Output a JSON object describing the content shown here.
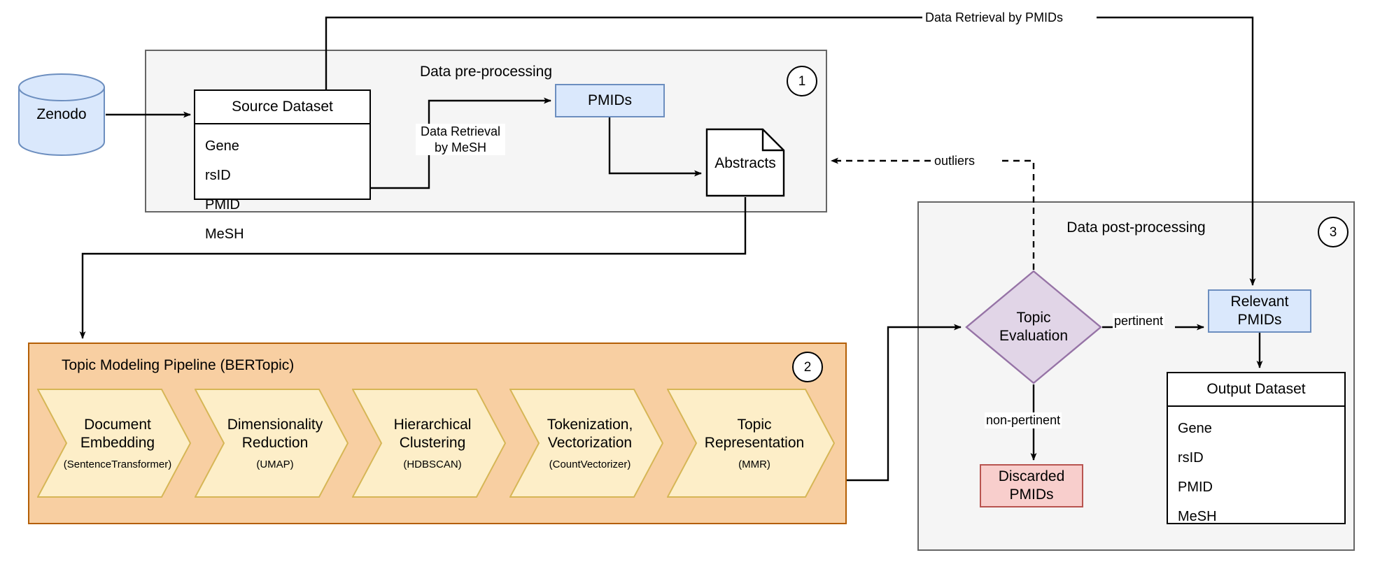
{
  "groups": {
    "preprocessing": {
      "title": "Data pre-processing",
      "badge": "1"
    },
    "pipeline": {
      "title": "Topic Modeling Pipeline (BERTopic)",
      "badge": "2"
    },
    "postprocessing": {
      "title": "Data post-processing",
      "badge": "3"
    }
  },
  "nodes": {
    "zenodo": {
      "label": "Zenodo"
    },
    "source_dataset": {
      "title": "Source Dataset",
      "fields": [
        "Gene",
        "rsID",
        "PMID",
        "MeSH"
      ]
    },
    "pmids": {
      "label": "PMIDs"
    },
    "abstracts": {
      "label": "Abstracts"
    },
    "topic_evaluation": {
      "label": "Topic\nEvaluation"
    },
    "relevant_pmids": {
      "label": "Relevant\nPMIDs"
    },
    "discarded_pmids": {
      "label": "Discarded\nPMIDs"
    },
    "output_dataset": {
      "title": "Output Dataset",
      "fields": [
        "Gene",
        "rsID",
        "PMID",
        "MeSH"
      ]
    }
  },
  "pipeline_steps": [
    {
      "title": "Document\nEmbedding",
      "sub": "(SentenceTransformer)"
    },
    {
      "title": "Dimensionality\nReduction",
      "sub": "(UMAP)"
    },
    {
      "title": "Hierarchical\nClustering",
      "sub": "(HDBSCAN)"
    },
    {
      "title": "Tokenization,\nVectorization",
      "sub": "(CountVectorizer)"
    },
    {
      "title": "Topic\nRepresentation",
      "sub": "(MMR)"
    }
  ],
  "edge_labels": {
    "retrieval_pmids": "Data Retrieval by PMIDs",
    "retrieval_mesh": "Data Retrieval\nby MeSH",
    "outliers": "outliers",
    "pertinent": "pertinent",
    "non_pertinent": "non-pertinent"
  },
  "colors": {
    "group_fill": "#f5f5f5",
    "group_stroke": "#666666",
    "blue_fill": "#dae8fc",
    "blue_stroke": "#6c8ebf",
    "red_fill": "#f8cecc",
    "red_stroke": "#b85450",
    "purple_fill": "#e1d5e7",
    "purple_stroke": "#9673a6",
    "orange_fill": "#f8cfa2",
    "orange_stroke": "#b45f06",
    "chevron_fill": "#fdeec8",
    "chevron_stroke": "#d6b656",
    "line": "#000000"
  }
}
